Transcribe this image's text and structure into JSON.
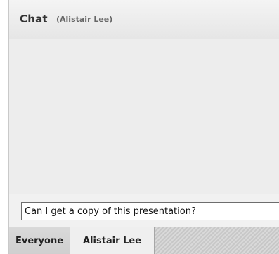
{
  "chat": {
    "title": "Chat",
    "subtitle": "(Alistair Lee)"
  },
  "input": {
    "value": "Can I get a copy of this presentation?"
  },
  "tabs": [
    {
      "label": "Everyone",
      "active": false
    },
    {
      "label": "Alistair Lee",
      "active": true
    }
  ]
}
